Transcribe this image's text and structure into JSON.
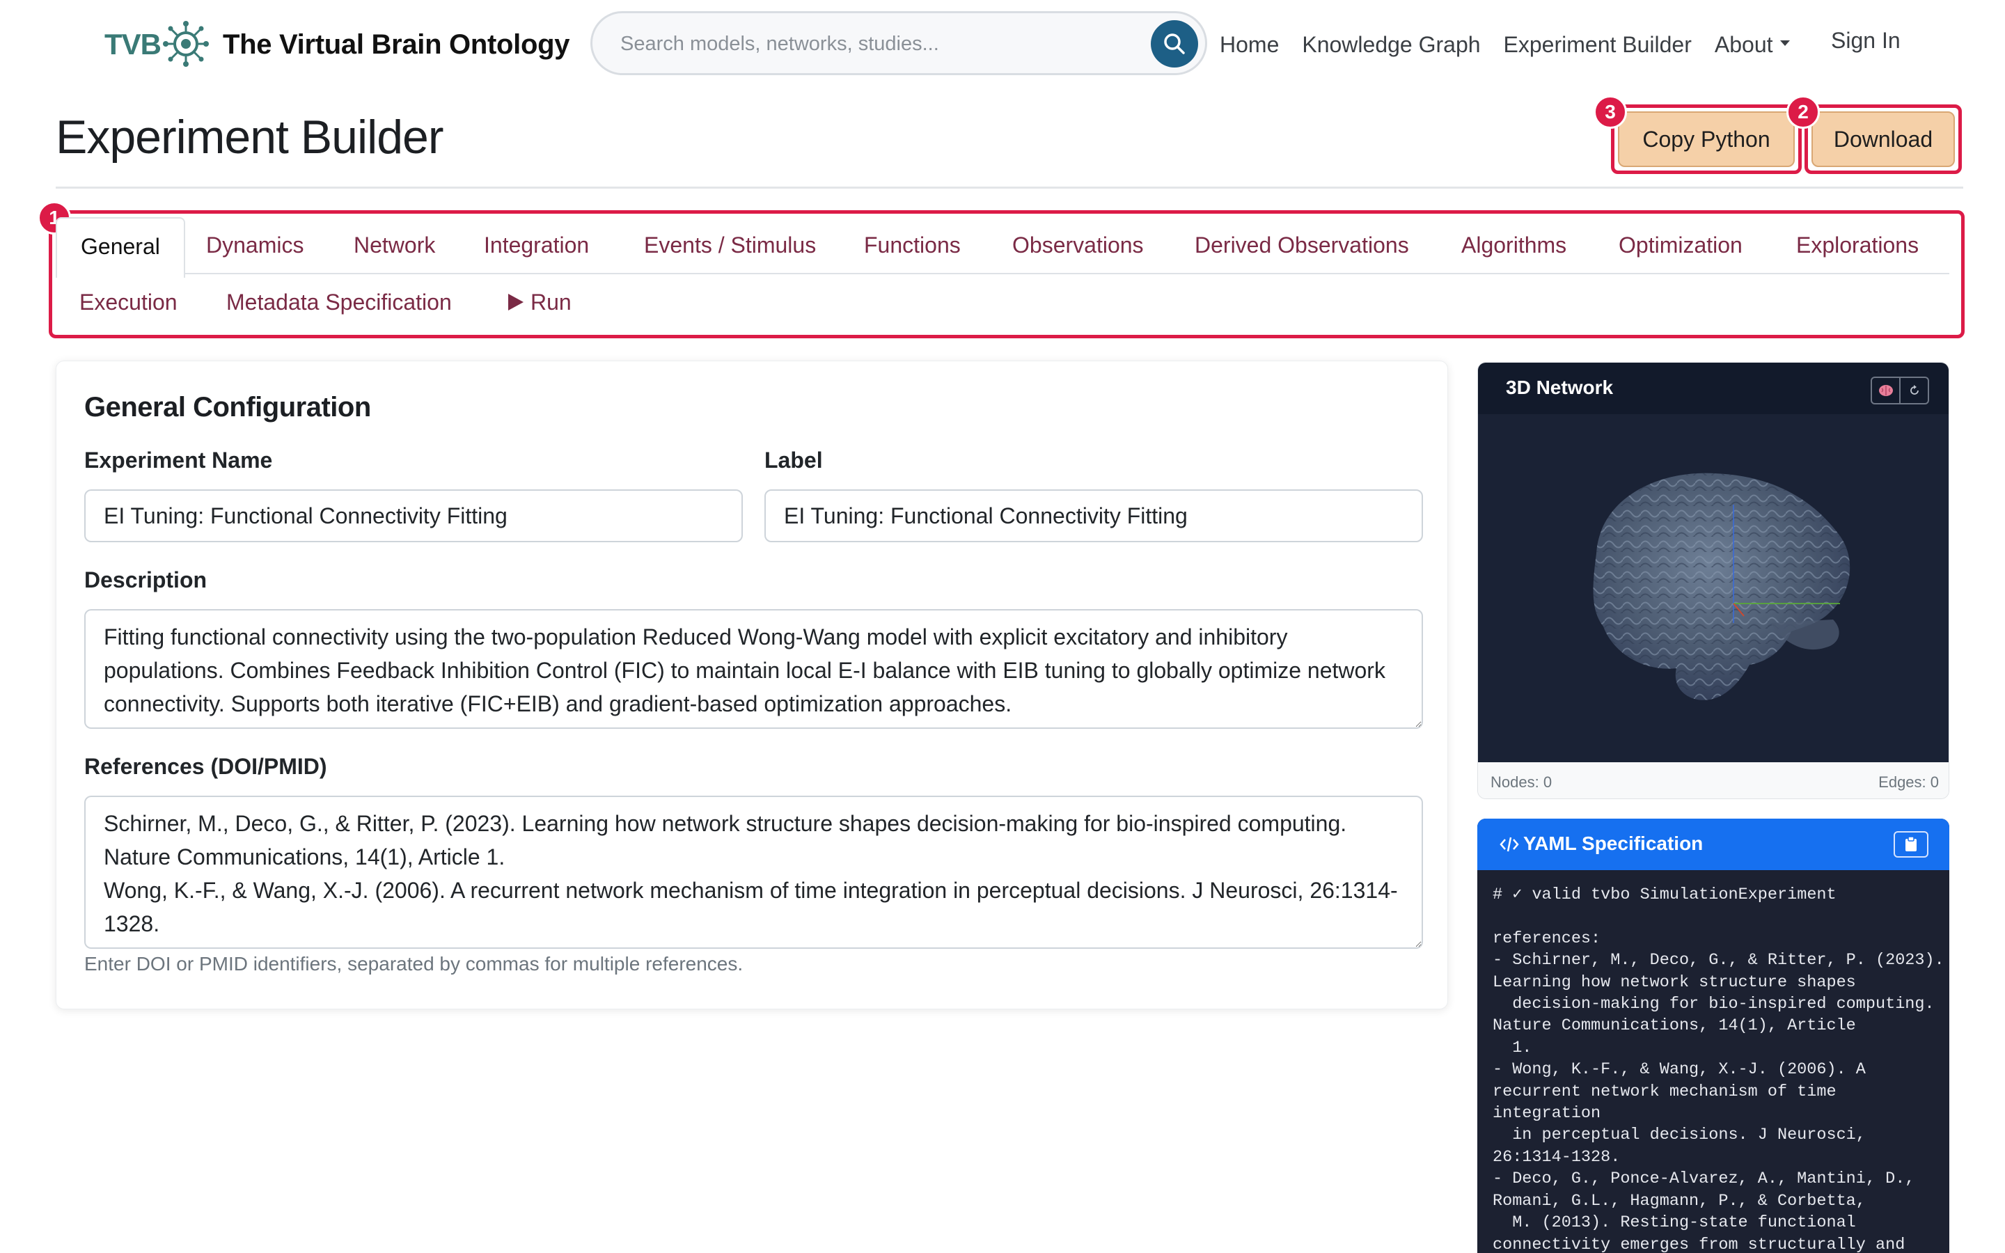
{
  "brand": {
    "logo_text": "TVB",
    "title": "The Virtual Brain Ontology"
  },
  "search": {
    "placeholder": "Search models, networks, studies..."
  },
  "nav": {
    "home": "Home",
    "knowledge_graph": "Knowledge Graph",
    "experiment_builder": "Experiment Builder",
    "about": "About",
    "sign_in": "Sign In"
  },
  "page": {
    "title": "Experiment Builder"
  },
  "actions": {
    "copy_python": "Copy Python",
    "download": "Download",
    "badge_copy": "3",
    "badge_download": "2",
    "badge_tabs": "1"
  },
  "tabs": [
    "General",
    "Dynamics",
    "Network",
    "Integration",
    "Events / Stimulus",
    "Functions",
    "Observations",
    "Derived Observations",
    "Algorithms",
    "Optimization",
    "Explorations",
    "Execution",
    "Metadata Specification",
    "Run"
  ],
  "general": {
    "card_title": "General Configuration",
    "experiment_name_label": "Experiment Name",
    "experiment_name_value": "EI Tuning: Functional Connectivity Fitting",
    "label_label": "Label",
    "label_value": "EI Tuning: Functional Connectivity Fitting",
    "description_label": "Description",
    "description_value": "Fitting functional connectivity using the two-population Reduced Wong-Wang model with explicit excitatory and inhibitory populations. Combines Feedback Inhibition Control (FIC) to maintain local E-I balance with EIB tuning to globally optimize network connectivity. Supports both iterative (FIC+EIB) and gradient-based optimization approaches.",
    "references_label": "References (DOI/PMID)",
    "references_value": "Schirner, M., Deco, G., & Ritter, P. (2023). Learning how network structure shapes decision-making for bio-inspired computing. Nature Communications, 14(1), Article 1.\nWong, K.-F., & Wang, X.-J. (2006). A recurrent network mechanism of time integration in perceptual decisions. J Neurosci, 26:1314-1328.",
    "references_help": "Enter DOI or PMID identifiers, separated by commas for multiple references."
  },
  "network_panel": {
    "title": "3D Network",
    "nodes": "Nodes: 0",
    "edges": "Edges: 0",
    "colors": {
      "header": "#121a2b",
      "canvas": "#1a2235"
    }
  },
  "yaml_panel": {
    "title": "YAML Specification",
    "content": "# ✓ valid tvbo SimulationExperiment\n\nreferences:\n- Schirner, M., Deco, G., & Ritter, P. (2023).\nLearning how network structure shapes\n  decision-making for bio-inspired computing.\nNature Communications, 14(1), Article\n  1.\n- Wong, K.-F., & Wang, X.-J. (2006). A\nrecurrent network mechanism of time\nintegration\n  in perceptual decisions. J Neurosci,\n26:1314-1328.\n- Deco, G., Ponce-Alvarez, A., Mantini, D.,\nRomani, G.L., Hagmann, P., & Corbetta,\n  M. (2013). Resting-state functional\nconnectivity emerges from structurally and"
  },
  "colors": {
    "accent_highlight": "#dc1b47",
    "tab_text": "#7a2a45",
    "button_peach": "#f5d0a8",
    "search_button": "#1d5f86",
    "yaml_header": "#1670f0"
  }
}
